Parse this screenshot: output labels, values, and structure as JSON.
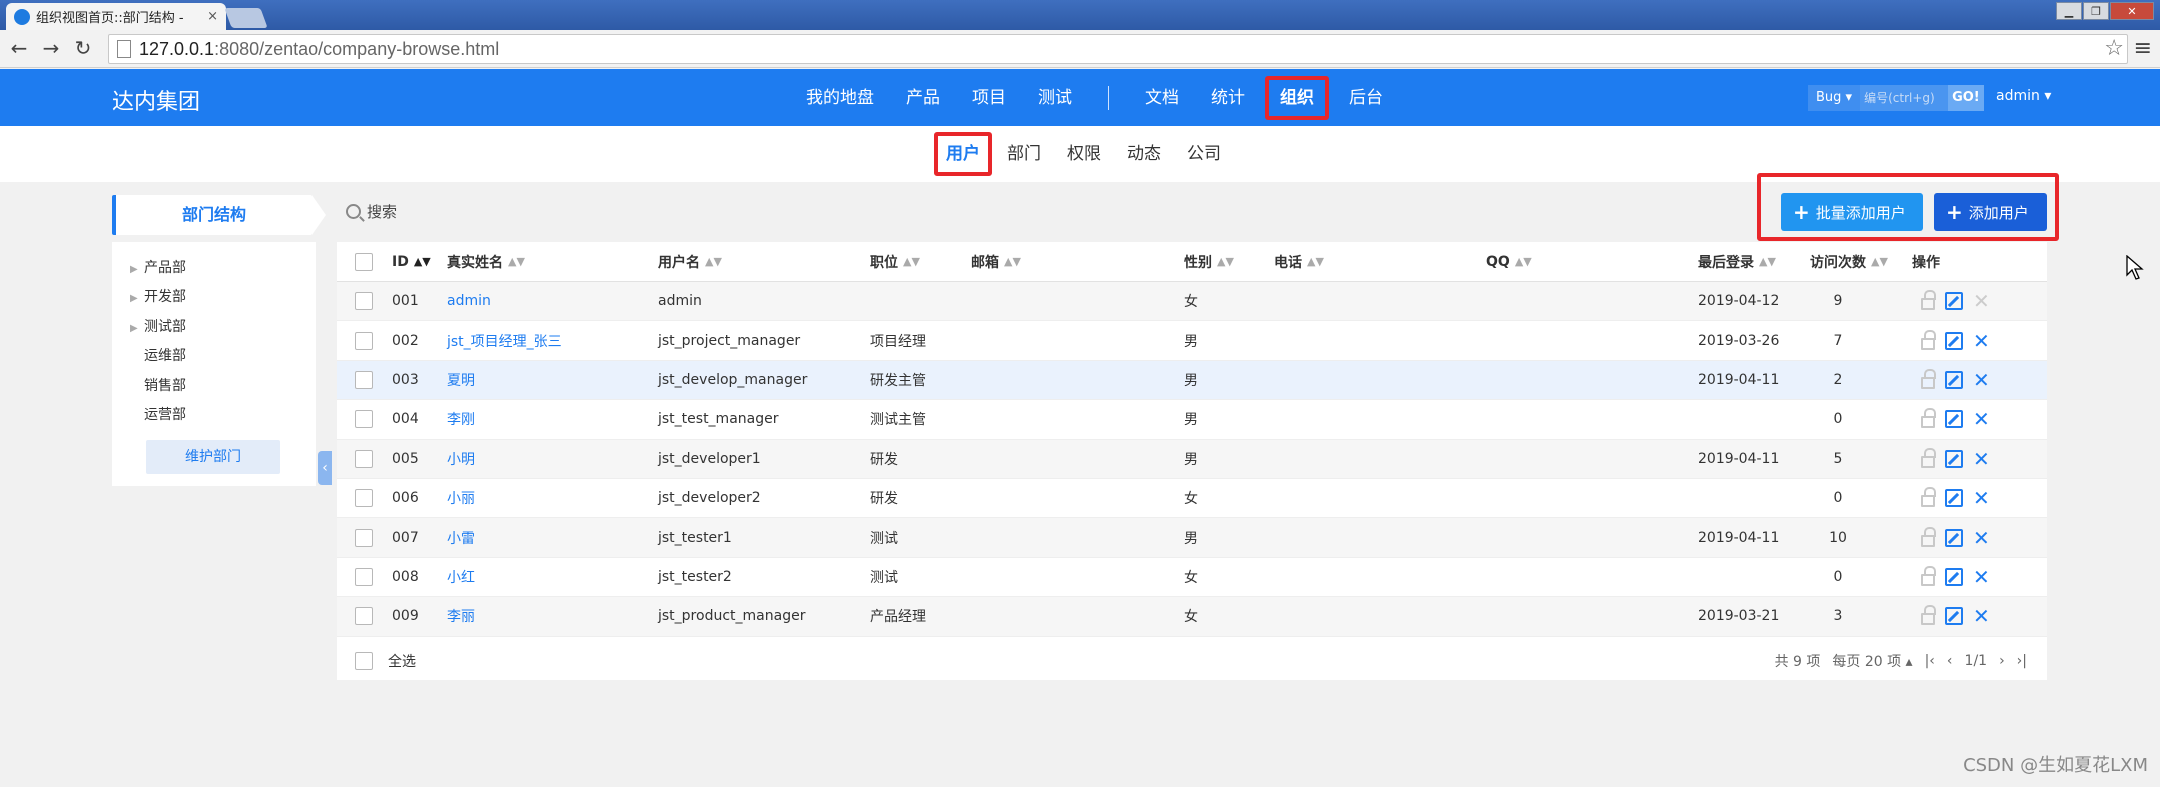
{
  "browser": {
    "tab_title": "组织视图首页::部门结构 -",
    "tab_close": "×",
    "url_host": "127.0.0.1",
    "url_rest": ":8080/zentao/company-browse.html",
    "win_minimize": "▁",
    "win_maximize": "❐",
    "win_close": "✕",
    "back": "←",
    "forward": "→",
    "reload": "↻",
    "star": "☆",
    "menu": "≡"
  },
  "header": {
    "brand": "达内集团",
    "nav": [
      "我的地盘",
      "产品",
      "项目",
      "测试",
      "文档",
      "统计",
      "组织",
      "后台"
    ],
    "active_nav": "组织",
    "search_type": "Bug ▾",
    "search_placeholder": "编号(ctrl+g)",
    "search_go": "GO!",
    "user": "admin ▾"
  },
  "subnav": {
    "items": [
      "用户",
      "部门",
      "权限",
      "动态",
      "公司"
    ],
    "active": "用户"
  },
  "sidebar": {
    "title": "部门结构",
    "departments": [
      {
        "name": "产品部",
        "expandable": true
      },
      {
        "name": "开发部",
        "expandable": true
      },
      {
        "name": "测试部",
        "expandable": true
      },
      {
        "name": "运维部",
        "expandable": false
      },
      {
        "name": "销售部",
        "expandable": false
      },
      {
        "name": "运营部",
        "expandable": false
      }
    ],
    "maintain_button": "维护部门",
    "collapse_glyph": "‹"
  },
  "toolbar": {
    "search_label": "搜索",
    "batch_add": "批量添加用户",
    "add_user": "添加用户"
  },
  "table": {
    "columns": [
      "ID",
      "真实姓名",
      "用户名",
      "职位",
      "邮箱",
      "性别",
      "电话",
      "QQ",
      "最后登录",
      "访问次数",
      "操作"
    ],
    "rows": [
      {
        "id": "001",
        "realname": "admin",
        "account": "admin",
        "role": "",
        "email": "",
        "gender": "女",
        "phone": "",
        "qq": "",
        "last": "2019-04-12",
        "visits": "9",
        "deletable": false
      },
      {
        "id": "002",
        "realname": "jst_项目经理_张三",
        "account": "jst_project_manager",
        "role": "项目经理",
        "email": "",
        "gender": "男",
        "phone": "",
        "qq": "",
        "last": "2019-03-26",
        "visits": "7",
        "deletable": true
      },
      {
        "id": "003",
        "realname": "夏明",
        "account": "jst_develop_manager",
        "role": "研发主管",
        "email": "",
        "gender": "男",
        "phone": "",
        "qq": "",
        "last": "2019-04-11",
        "visits": "2",
        "deletable": true
      },
      {
        "id": "004",
        "realname": "李刚",
        "account": "jst_test_manager",
        "role": "测试主管",
        "email": "",
        "gender": "男",
        "phone": "",
        "qq": "",
        "last": "",
        "visits": "0",
        "deletable": true
      },
      {
        "id": "005",
        "realname": "小明",
        "account": "jst_developer1",
        "role": "研发",
        "email": "",
        "gender": "男",
        "phone": "",
        "qq": "",
        "last": "2019-04-11",
        "visits": "5",
        "deletable": true
      },
      {
        "id": "006",
        "realname": "小丽",
        "account": "jst_developer2",
        "role": "研发",
        "email": "",
        "gender": "女",
        "phone": "",
        "qq": "",
        "last": "",
        "visits": "0",
        "deletable": true
      },
      {
        "id": "007",
        "realname": "小雷",
        "account": "jst_tester1",
        "role": "测试",
        "email": "",
        "gender": "男",
        "phone": "",
        "qq": "",
        "last": "2019-04-11",
        "visits": "10",
        "deletable": true
      },
      {
        "id": "008",
        "realname": "小红",
        "account": "jst_tester2",
        "role": "测试",
        "email": "",
        "gender": "女",
        "phone": "",
        "qq": "",
        "last": "",
        "visits": "0",
        "deletable": true
      },
      {
        "id": "009",
        "realname": "李丽",
        "account": "jst_product_manager",
        "role": "产品经理",
        "email": "",
        "gender": "女",
        "phone": "",
        "qq": "",
        "last": "2019-03-21",
        "visits": "3",
        "deletable": true
      }
    ],
    "select_all": "全选",
    "total": "共 9 项",
    "per_page": "每页 20 项 ▴",
    "page": "1/1"
  },
  "watermark": "CSDN @生如夏花LXM",
  "colors": {
    "accent": "#1e7cf0",
    "highlight_box": "#e8262a"
  }
}
